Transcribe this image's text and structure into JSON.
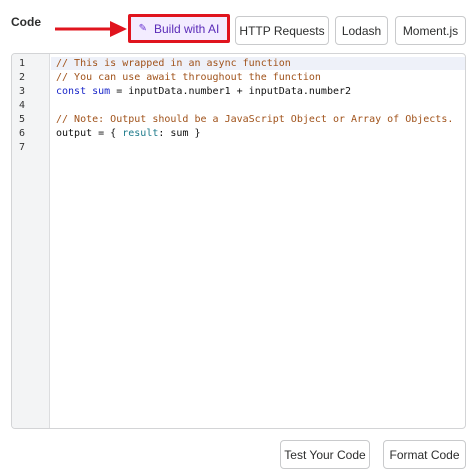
{
  "section": {
    "label": "Code"
  },
  "toolbar": {
    "build_ai_label": "Build with AI",
    "http_label": "HTTP Requests",
    "lodash_label": "Lodash",
    "moment_label": "Moment.js"
  },
  "editor": {
    "line_numbers": [
      "1",
      "2",
      "3",
      "4",
      "5",
      "6",
      "7"
    ],
    "lines": {
      "l1": "// This is wrapped in an async function",
      "l2": "// You can use await throughout the function",
      "l3_kw": "const",
      "l3_var": "sum",
      "l3_rest": " = inputData.number1 + inputData.number2",
      "l5": "// Note: Output should be a JavaScript Object or Array of Objects.",
      "l6_pre": "output = { ",
      "l6_prop": "result",
      "l6_post": ": sum }"
    }
  },
  "footer": {
    "test_label": "Test Your Code",
    "format_label": "Format Code"
  },
  "colors": {
    "highlight_border": "#e0141e",
    "ai_button_bg": "#f3ecff",
    "ai_button_text": "#5a2bb8",
    "comment": "#a0521a",
    "keyword": "#1a27c9"
  },
  "icons": {
    "ai": "sparkle-icon",
    "annotation": "red-arrow"
  }
}
